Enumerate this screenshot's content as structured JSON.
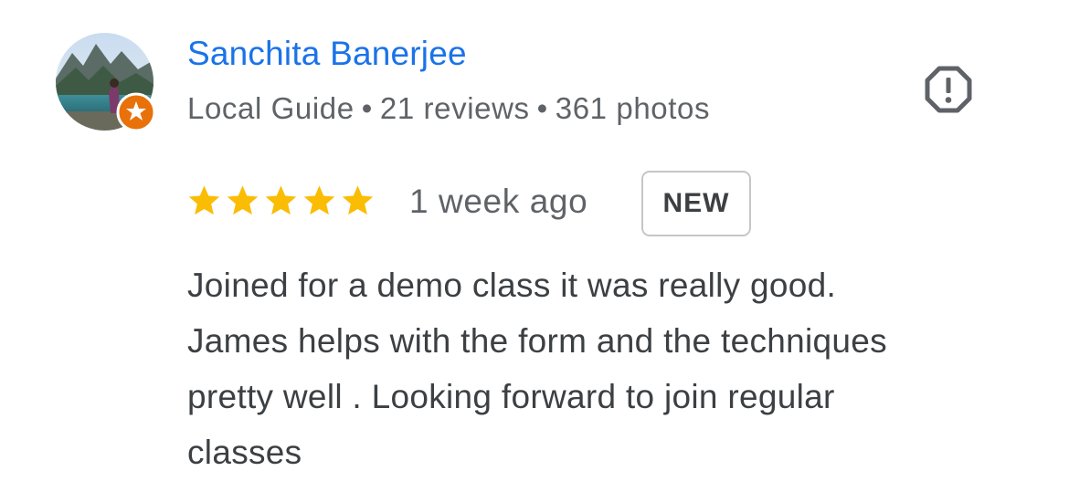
{
  "reviewer": {
    "name": "Sanchita Banerjee",
    "role": "Local Guide",
    "separator": "•",
    "reviews": "21 reviews",
    "photos": "361 photos"
  },
  "review": {
    "rating": 5,
    "max_rating": 5,
    "time": "1 week ago",
    "badge": "NEW",
    "text_lines": [
      "Joined for a demo class it was really good.",
      "James helps with the form and the techniques",
      "pretty well . Looking forward to join regular",
      "classes"
    ]
  },
  "icons": {
    "flag": "report-flag-icon",
    "guide_badge": "local-guide-badge-icon",
    "star": "star-icon"
  },
  "colors": {
    "name": "#1a73e8",
    "star": "#fbbc04",
    "guide_badge": "#e8710a",
    "meta_text": "#5f6368"
  }
}
